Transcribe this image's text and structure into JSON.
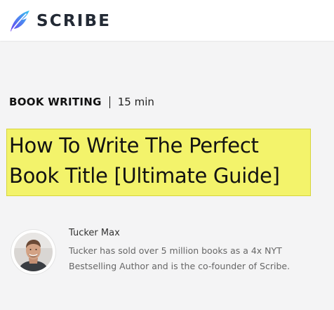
{
  "header": {
    "logo_text": "SCRIBE",
    "logo_icon": "feather-logo-icon"
  },
  "article": {
    "category": "BOOK WRITING",
    "read_time": "15 min",
    "title_line1": "How To Write The Perfect",
    "title_line2": "Book Title [Ultimate Guide]",
    "highlight_color": "#f3f36b"
  },
  "author": {
    "name": "Tucker Max",
    "bio_line1": "Tucker has sold over 5 million books as a 4x NYT",
    "bio_line2": "Bestselling Author and is the co-founder of Scribe."
  },
  "colors": {
    "logo_gradient_start": "#6a3cf0",
    "logo_gradient_end": "#37c5f0",
    "logo_text": "#232a35",
    "page_background": "#f4f4f5"
  }
}
